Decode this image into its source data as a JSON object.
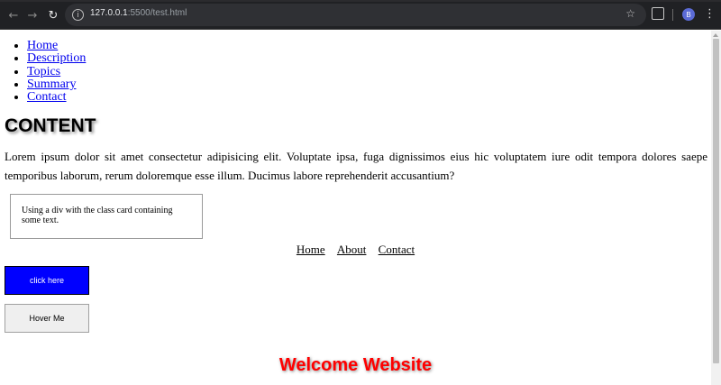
{
  "browser": {
    "url_host": "127.0.0.1",
    "url_path": ":5500/test.html",
    "avatar_letter": "B",
    "icons": [
      "back-arrow-icon",
      "forward-arrow-icon",
      "reload-icon",
      "info-icon",
      "star-icon",
      "extensions-icon",
      "menu-icon"
    ]
  },
  "nav": {
    "items": [
      "Home",
      "Description",
      "Topics",
      "Summary",
      "Contact"
    ]
  },
  "content": {
    "heading": "CONTENT",
    "paragraph": "Lorem ipsum dolor sit amet consectetur adipisicing elit. Voluptate ipsa, fuga dignissimos eius hic voluptatem iure odit tempora dolores saepe temporibus laborum, rerum doloremque esse illum. Ducimus labore reprehenderit accusantium?",
    "card_text": "Using a div with the class card containing some text."
  },
  "bottom_nav": {
    "items": [
      "Home",
      "About",
      "Contact"
    ]
  },
  "buttons": {
    "click_label": "click here",
    "hover_label": "Hover Me"
  },
  "footer": {
    "welcome": "Welcome Website"
  },
  "colors": {
    "chrome_bg": "#202124",
    "link": "#0000ee",
    "click_button_bg": "#0000ff",
    "welcome_text": "#ff0000"
  }
}
